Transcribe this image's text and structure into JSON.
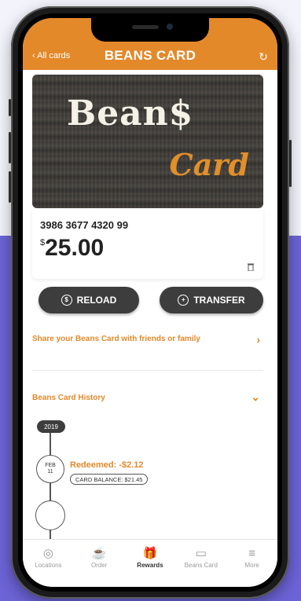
{
  "header": {
    "back_label": "‹ All cards",
    "title": "BEANS CARD",
    "refresh_icon": "↻"
  },
  "card": {
    "brand_line1": "Bean$",
    "brand_line2": "Card",
    "number": "3986 3677 4320 99",
    "currency_symbol": "$",
    "balance": "25.00"
  },
  "actions": {
    "reload_icon": "$",
    "reload_label": "RELOAD",
    "transfer_icon": "+",
    "transfer_label": "TRANSFER"
  },
  "share": {
    "label": "Share your Beans Card with friends or family",
    "chevron": "›"
  },
  "history": {
    "label": "Beans Card History",
    "chevron": "⌄",
    "year": "2019",
    "entries": [
      {
        "month": "FEB",
        "day": "11",
        "title": "Redeemed: -$2.12",
        "balance": "CARD BALANCE: $21.45"
      }
    ]
  },
  "tabs": [
    {
      "label": "Locations",
      "icon": "◎"
    },
    {
      "label": "Order",
      "icon": "☕"
    },
    {
      "label": "Rewards",
      "icon": "🎁"
    },
    {
      "label": "Beans Card",
      "icon": "▭"
    },
    {
      "label": "More",
      "icon": "≡"
    }
  ],
  "colors": {
    "accent": "#e3892a",
    "dark_button": "#3d3d3d",
    "background_purple": "#6c63d6"
  }
}
